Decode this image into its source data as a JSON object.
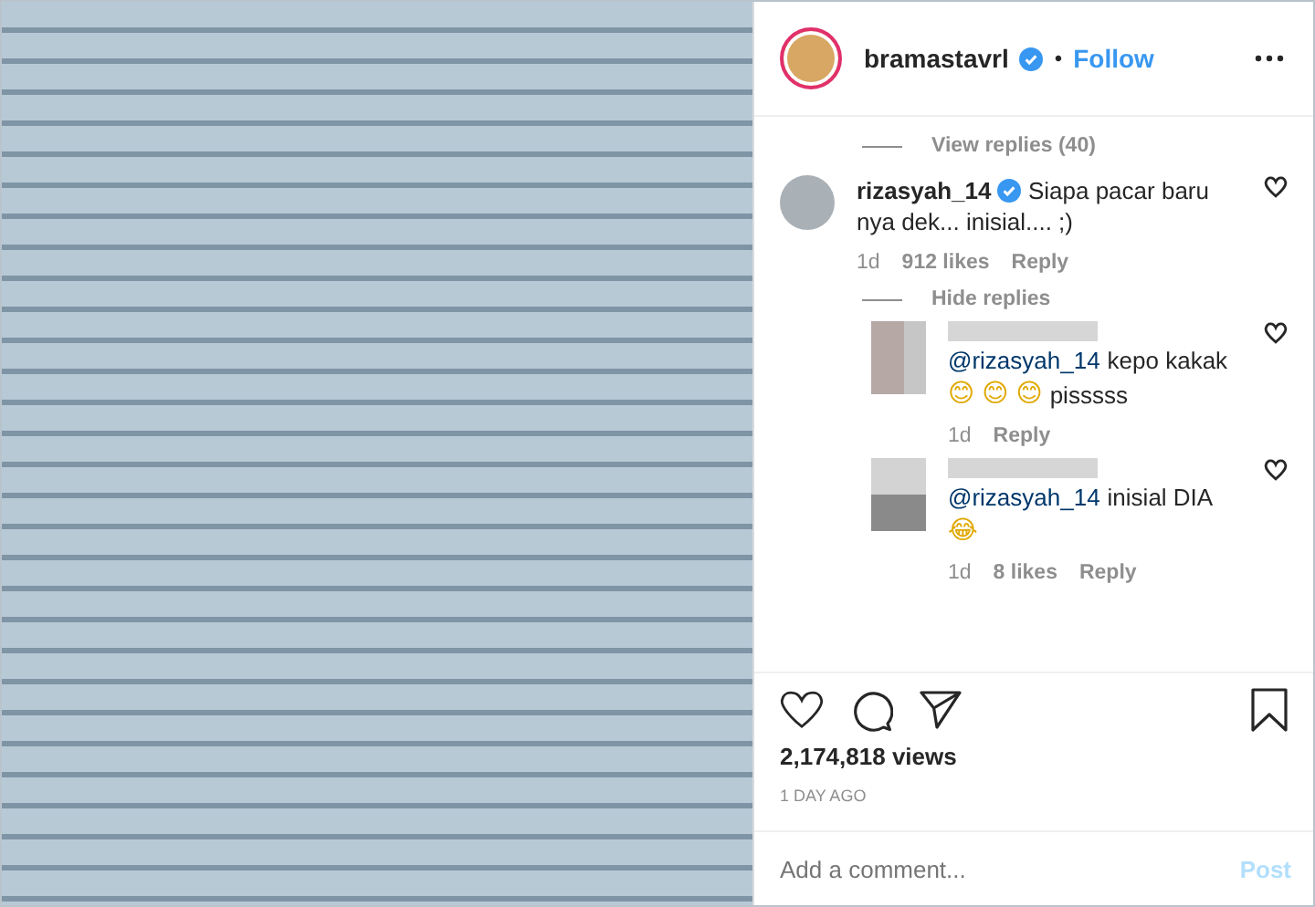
{
  "header": {
    "username": "bramastavrl",
    "verified": true,
    "separator": "•",
    "follow": "Follow"
  },
  "view_replies": "View replies (40)",
  "comment": {
    "username": "rizasyah_14",
    "verified": true,
    "text": "Siapa pacar baru nya dek... inisial.... ;)",
    "time": "1d",
    "likes": "912 likes",
    "reply": "Reply",
    "replies_toggle": "Hide replies"
  },
  "replies": [
    {
      "name_blurred": true,
      "parts": [
        {
          "kind": "mention",
          "text": "@rizasyah_14"
        },
        {
          "kind": "text",
          "text": "kepo kakak"
        },
        {
          "kind": "emoji",
          "text": "😊"
        },
        {
          "kind": "emoji",
          "text": "😊"
        },
        {
          "kind": "emoji",
          "text": "😊"
        },
        {
          "kind": "text",
          "text": "pisssss"
        }
      ],
      "time": "1d",
      "reply": "Reply"
    },
    {
      "name_blurred": true,
      "parts": [
        {
          "kind": "mention",
          "text": "@rizasyah_14"
        },
        {
          "kind": "text",
          "text": "inisial DIA"
        },
        {
          "kind": "emoji",
          "text": "😂"
        }
      ],
      "time": "1d",
      "likes": "8 likes",
      "reply": "Reply"
    }
  ],
  "views": "2,174,818 views",
  "posted": "1 DAY AGO",
  "comment_field": {
    "placeholder": "Add a comment...",
    "post": "Post",
    "post_disabled": true
  }
}
